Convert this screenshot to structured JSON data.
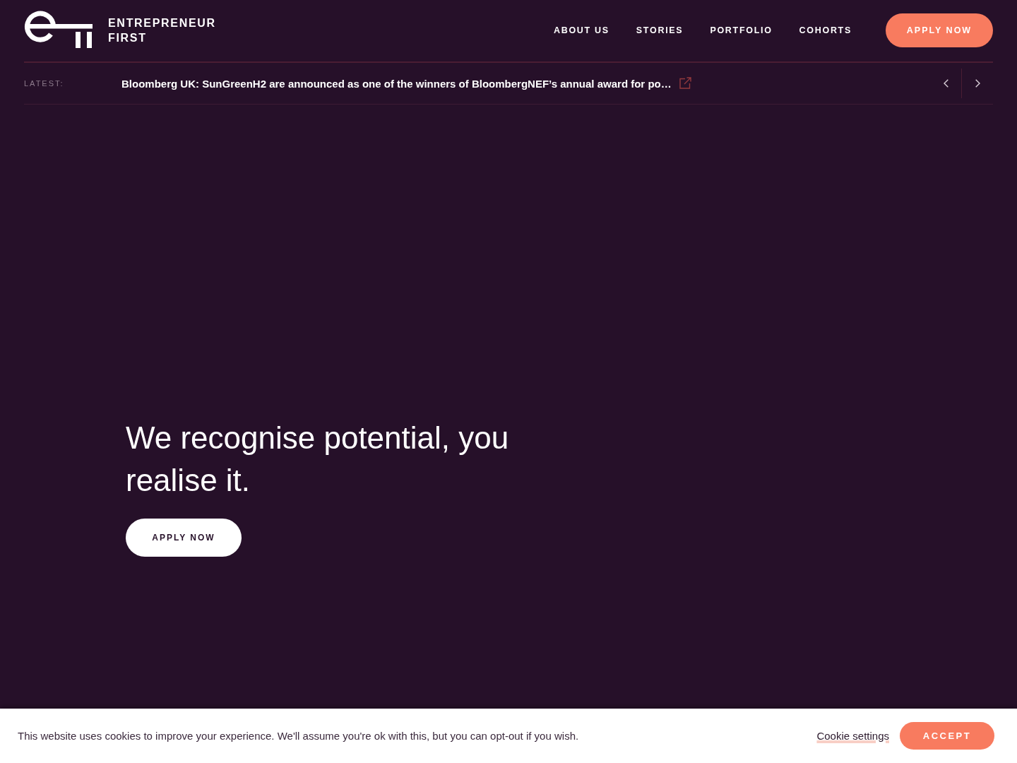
{
  "header": {
    "logo": {
      "wordmark_lines": [
        "ENTREPRENEUR",
        "FIRST"
      ]
    },
    "nav_links": [
      "ABOUT US",
      "STORIES",
      "PORTFOLIO",
      "COHORTS"
    ],
    "cta": "APPLY NOW"
  },
  "news_ticker": {
    "label": "LATEST:",
    "headline": "Bloomberg UK: SunGreenH2 are announced as one of the winners of BloombergNEF’s annual award for po…"
  },
  "hero": {
    "heading": "We recognise potential, you realise it.",
    "cta": "APPLY NOW"
  },
  "cookie_banner": {
    "message": "This website uses cookies to improve your experience. We'll assume you're ok with this, but you can opt-out if you wish.",
    "settings_link": "Cookie settings",
    "accept": "ACCEPT"
  }
}
